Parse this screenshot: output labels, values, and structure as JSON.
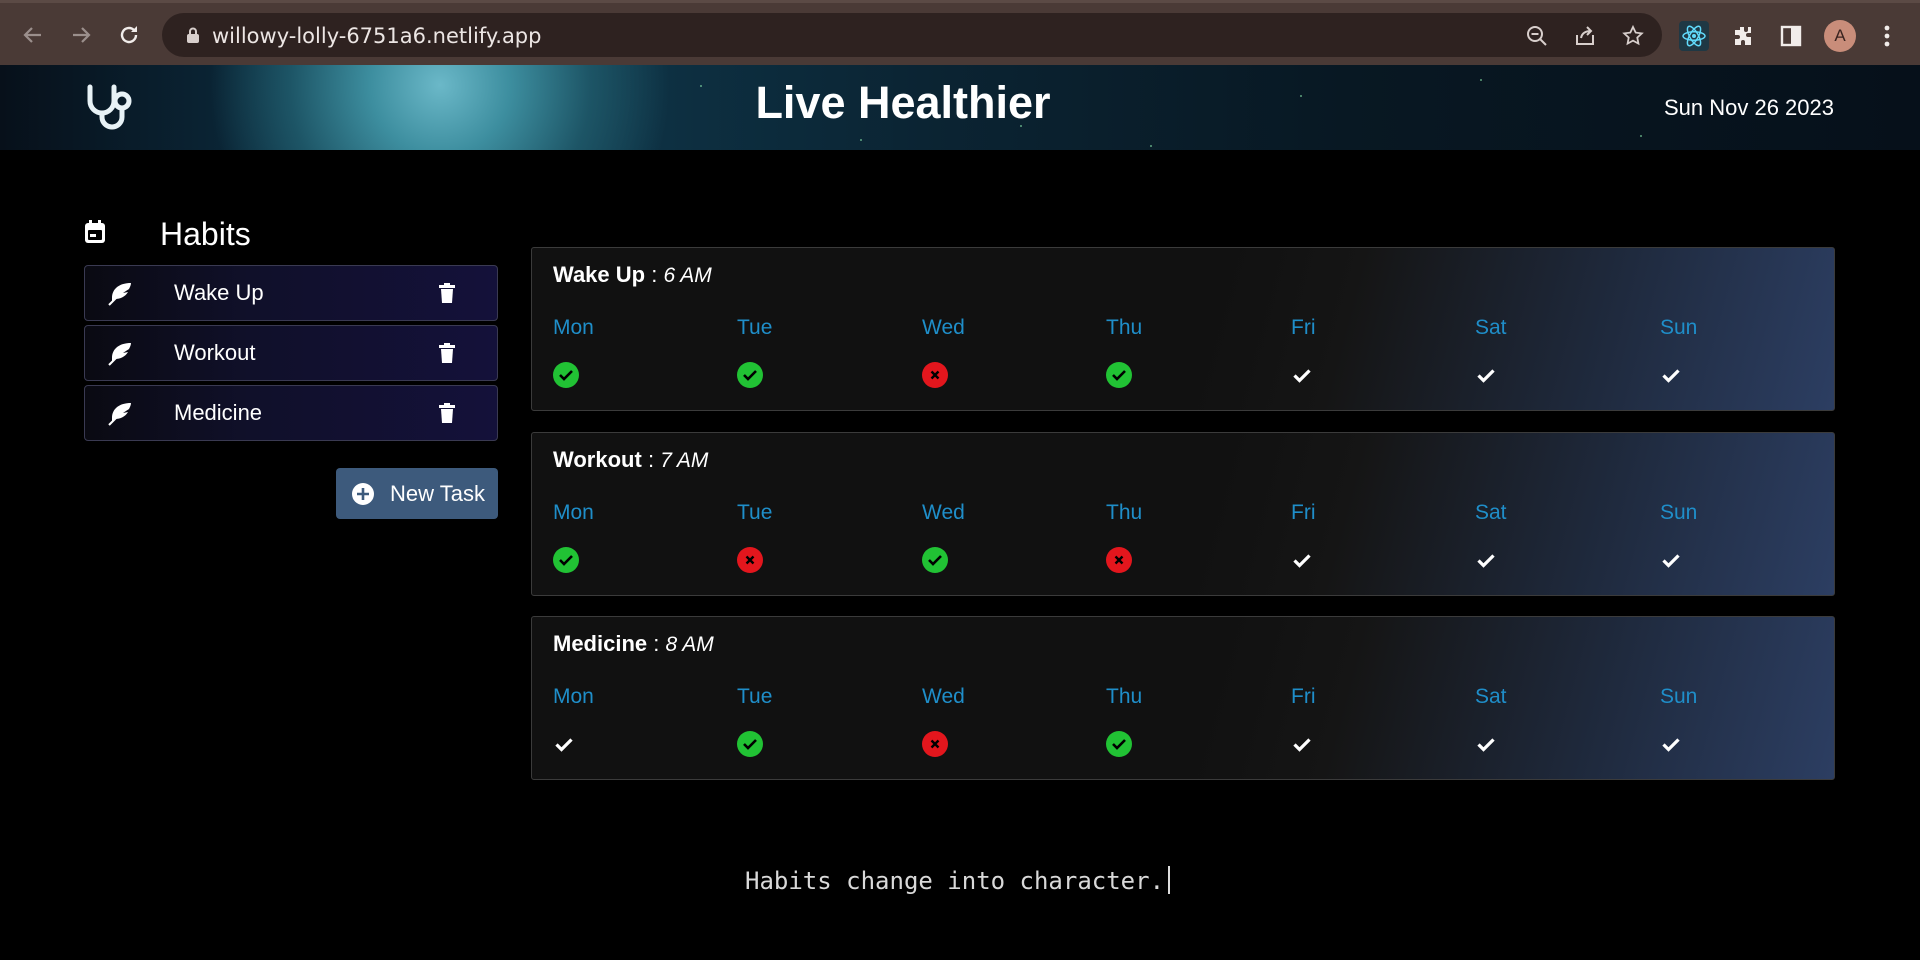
{
  "browser": {
    "url": "willowy-lolly-6751a6.netlify.app",
    "profile_initial": "A"
  },
  "header": {
    "title": "Live Healthier",
    "date": "Sun Nov 26 2023",
    "logo_icon": "stethoscope-icon"
  },
  "sidebar": {
    "title": "Habits",
    "habits": [
      {
        "name": "Wake Up"
      },
      {
        "name": "Workout"
      },
      {
        "name": "Medicine"
      }
    ],
    "new_task_label": "New Task"
  },
  "days": [
    "Mon",
    "Tue",
    "Wed",
    "Thu",
    "Fri",
    "Sat",
    "Sun"
  ],
  "cards": [
    {
      "name": "Wake Up",
      "separator": ":",
      "time": "6 AM",
      "status": [
        "done",
        "done",
        "missed",
        "done",
        "pending",
        "pending",
        "pending"
      ]
    },
    {
      "name": "Workout",
      "separator": ":",
      "time": "7 AM",
      "status": [
        "done",
        "missed",
        "done",
        "missed",
        "pending",
        "pending",
        "pending"
      ]
    },
    {
      "name": "Medicine",
      "separator": ":",
      "time": "8 AM",
      "status": [
        "pending",
        "done",
        "missed",
        "done",
        "pending",
        "pending",
        "pending"
      ]
    }
  ],
  "colors": {
    "done": "#21c234",
    "missed": "#e3161d",
    "day_label": "#1f8ec9",
    "button": "#3d5a7c"
  },
  "footer": {
    "quote": "Habits change into character."
  }
}
